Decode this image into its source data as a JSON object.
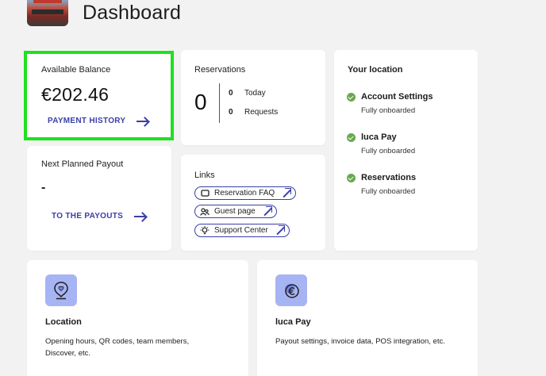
{
  "header": {
    "title": "Dashboard",
    "avatar_icon": "venue-photo-avatar"
  },
  "balance_card": {
    "label": "Available Balance",
    "amount": "€202.46",
    "link_label": "PAYMENT HISTORY",
    "highlight_color": "#1fe01f"
  },
  "payout_card": {
    "label": "Next Planned Payout",
    "value": "-",
    "link_label": "TO THE PAYOUTS"
  },
  "reservations_card": {
    "label": "Reservations",
    "total": "0",
    "rows": [
      {
        "count": "0",
        "label": "Today"
      },
      {
        "count": "0",
        "label": "Requests"
      }
    ]
  },
  "links_card": {
    "label": "Links",
    "items": [
      {
        "label": "Reservation FAQ",
        "icon": "ticket-icon"
      },
      {
        "label": "Guest page",
        "icon": "guests-icon"
      },
      {
        "label": "Support Center",
        "icon": "lightbulb-icon"
      }
    ]
  },
  "location_card": {
    "title": "Your location",
    "items": [
      {
        "title": "Account Settings",
        "status": "Fully onboarded"
      },
      {
        "title": "luca Pay",
        "status": "Fully onboarded"
      },
      {
        "title": "Reservations",
        "status": "Fully onboarded"
      }
    ],
    "check_color": "#6aa84f"
  },
  "features": [
    {
      "title": "Location",
      "description": "Opening hours, QR codes, team members, Discover, etc.",
      "icon": "location-pin-icon"
    },
    {
      "title": "luca Pay",
      "description": "Payout settings, invoice data, POS integration, etc.",
      "icon": "euro-coin-icon"
    }
  ],
  "colors": {
    "accent": "#3a3fa6",
    "feature_icon_bg": "#a7b4f3",
    "background": "#f2f2f2"
  }
}
